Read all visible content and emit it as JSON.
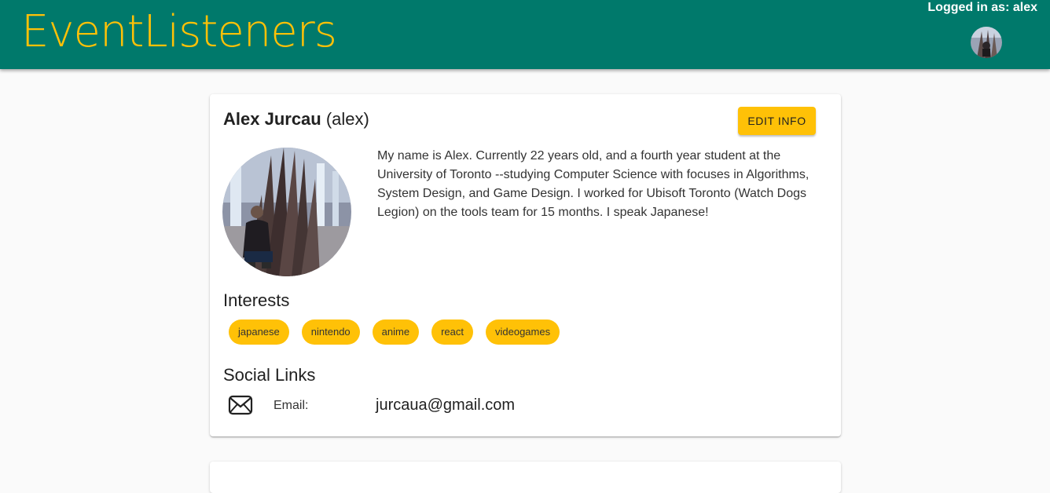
{
  "app": {
    "brand": "EventListeners",
    "logged_in_text": "Logged in as: alex"
  },
  "colors": {
    "header_bg": "#00796b",
    "accent": "#ffc107",
    "page_bg": "#fafafa",
    "card_bg": "#ffffff"
  },
  "profile": {
    "full_name": "Alex Jurcau",
    "username_display": "(alex)",
    "edit_button_label": "Edit Info",
    "bio": "My name is Alex. Currently 22 years old, and a fourth year student at the University of Toronto --studying Computer Science with focuses in Algorithms, System Design, and Game Design. I worked for Ubisoft Toronto (Watch Dogs Legion) on the tools team for 15 months. I speak Japanese!",
    "interests_title": "Interests",
    "interests": [
      "japanese",
      "nintendo",
      "anime",
      "react",
      "videogames"
    ],
    "social_title": "Social Links",
    "social": [
      {
        "icon": "mail-icon",
        "label": "Email:",
        "value": "jurcaua@gmail.com"
      }
    ]
  }
}
